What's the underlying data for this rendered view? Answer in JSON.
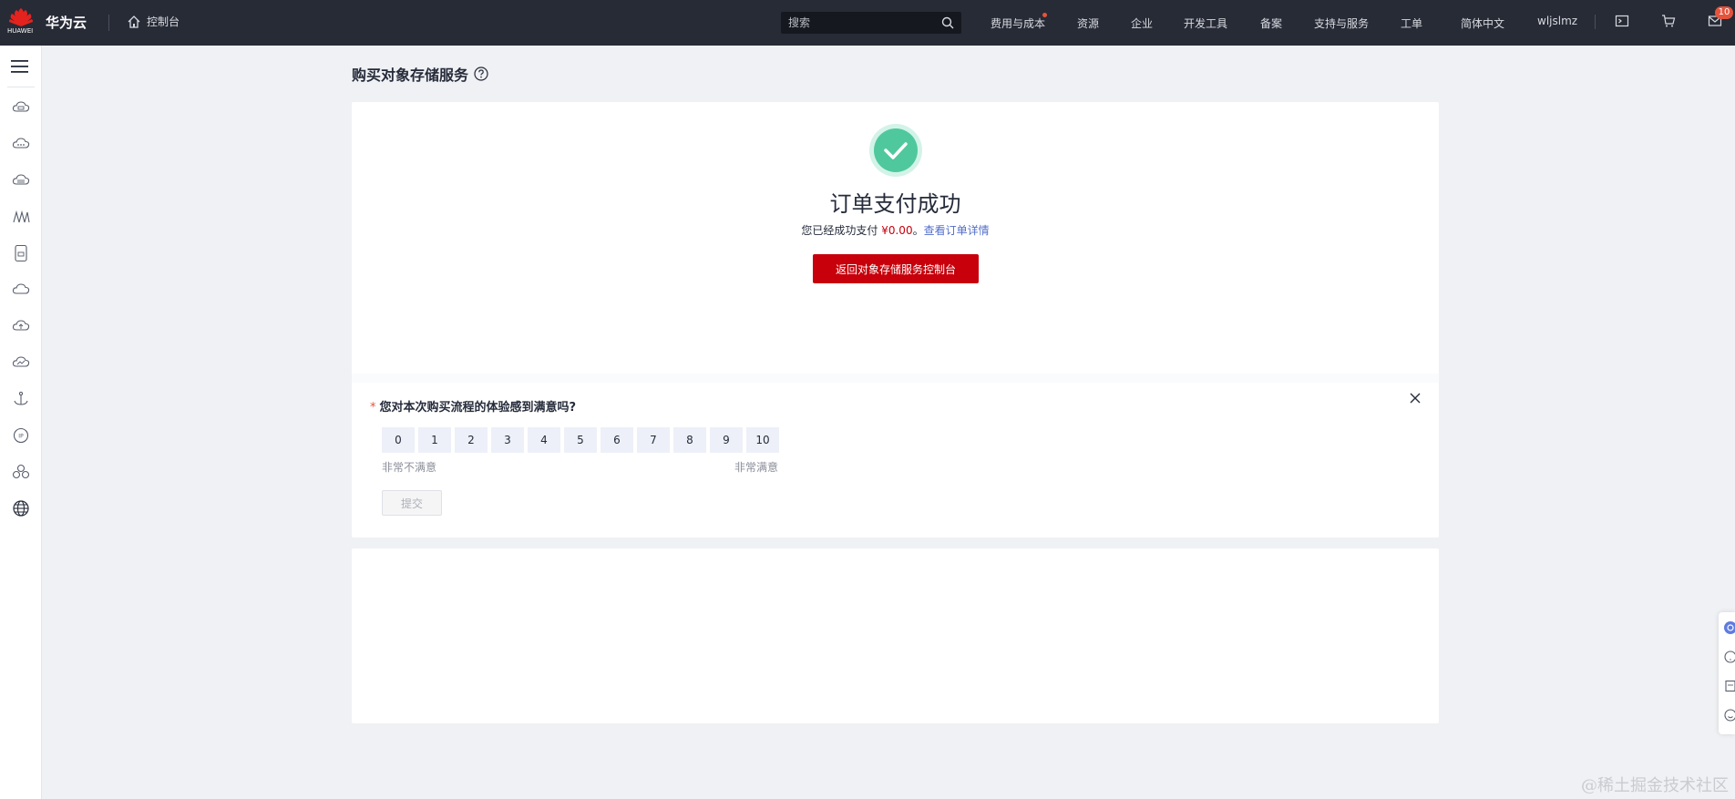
{
  "header": {
    "logo_text": "HUAWEI",
    "brand": "华为云",
    "console_label": "控制台",
    "search_placeholder": "搜索",
    "nav": [
      "费用与成本",
      "资源",
      "企业",
      "开发工具",
      "备案",
      "支持与服务",
      "工单",
      "简体中文",
      "wljslmz"
    ],
    "message_badge": "10"
  },
  "sidebar": {
    "icons": [
      "cloud-server-icon",
      "cloud-icon",
      "database-icon",
      "network-icon",
      "storage-icon",
      "cloud-outline-icon",
      "cloud-upload-icon",
      "cloud-monitor-icon",
      "anchor-icon",
      "ip-icon",
      "cluster-icon",
      "globe-icon"
    ]
  },
  "page": {
    "title": "购买对象存储服务"
  },
  "result": {
    "title": "订单支付成功",
    "desc_prefix": "您已经成功支付 ",
    "amount": "¥0.00",
    "desc_sep": "。",
    "detail_link": "查看订单详情",
    "back_button": "返回对象存储服务控制台"
  },
  "survey": {
    "question": "您对本次购买流程的体验感到满意吗?",
    "scores": [
      "0",
      "1",
      "2",
      "3",
      "4",
      "5",
      "6",
      "7",
      "8",
      "9",
      "10"
    ],
    "low_label": "非常不满意",
    "high_label": "非常满意",
    "submit": "提交"
  },
  "watermark": "@稀土掘金技术社区",
  "colors": {
    "brand_red": "#c7000b",
    "topbar": "#272b36",
    "success": "#4fc89d",
    "link": "#526ecc"
  }
}
